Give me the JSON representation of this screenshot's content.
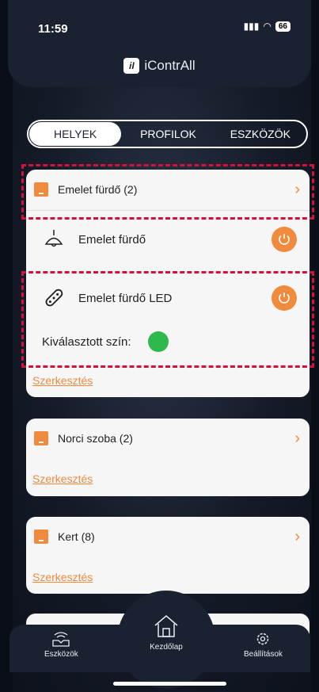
{
  "status": {
    "time": "11:59",
    "battery": "66"
  },
  "brand": {
    "logo": "iI",
    "name": "iContrAll"
  },
  "tabs": [
    "HELYEK",
    "PROFILOK",
    "ESZKÖZÖK"
  ],
  "rooms": [
    {
      "title": "Emelet fürdő (2)",
      "edit": "Szerkesztés",
      "devices": [
        {
          "name": "Emelet fürdő",
          "icon": "ceiling-lamp-icon"
        },
        {
          "name": "Emelet fürdő LED",
          "icon": "led-strip-icon"
        }
      ],
      "color_label": "Kiválasztott szín:",
      "selected_color": "#2db84b"
    },
    {
      "title": "Norci szoba (2)",
      "edit": "Szerkesztés"
    },
    {
      "title": "Kert (8)",
      "edit": "Szerkesztés"
    }
  ],
  "nav": {
    "devices": "Eszközök",
    "home": "Kezdőlap",
    "settings": "Beállítások"
  },
  "colors": {
    "accent": "#f08a3c",
    "header": "#1a2130",
    "highlight": "#d3123c"
  }
}
